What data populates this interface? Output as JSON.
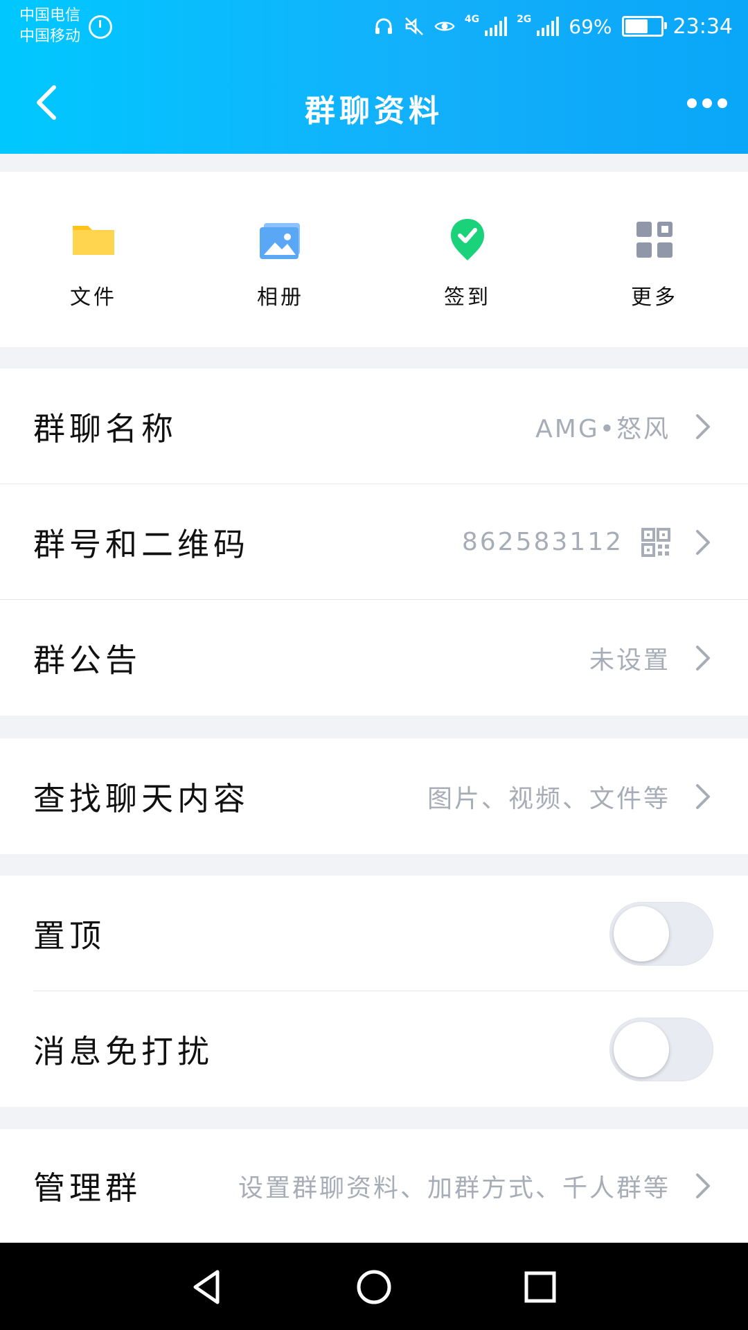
{
  "status_bar": {
    "carrier_1": "中国电信",
    "carrier_2": "中国移动",
    "net_4g": "4G",
    "net_2g": "2G",
    "battery": "69%",
    "time": "23:34"
  },
  "header": {
    "title": "群聊资料"
  },
  "quick_actions": [
    {
      "label": "文件",
      "icon": "folder-icon"
    },
    {
      "label": "相册",
      "icon": "album-icon"
    },
    {
      "label": "签到",
      "icon": "checkin-icon"
    },
    {
      "label": "更多",
      "icon": "grid-icon"
    }
  ],
  "rows": {
    "group_name": {
      "label": "群聊名称",
      "value": "AMG•怒风"
    },
    "group_number": {
      "label": "群号和二维码",
      "value": "862583112"
    },
    "announcement": {
      "label": "群公告",
      "value": "未设置"
    },
    "search_chat": {
      "label": "查找聊天内容",
      "value": "图片、视频、文件等"
    },
    "pin_top": {
      "label": "置顶"
    },
    "do_not_disturb": {
      "label": "消息免打扰"
    },
    "manage_group": {
      "label": "管理群",
      "value": "设置群聊资料、加群方式、千人群等"
    }
  },
  "colors": {
    "header_start": "#00c8ff",
    "header_end": "#0aa6f8",
    "folder": "#ffc21a",
    "album": "#5aa8f5",
    "checkin": "#19d27a",
    "grid": "#8f97a8"
  }
}
